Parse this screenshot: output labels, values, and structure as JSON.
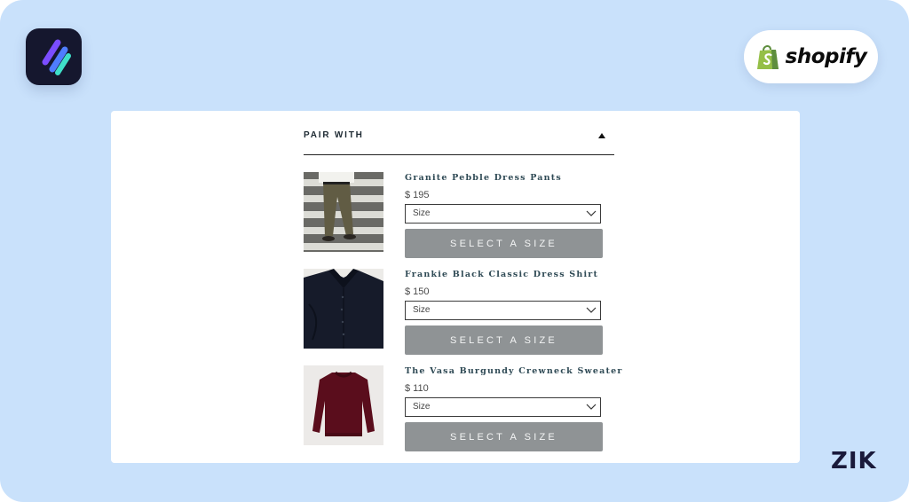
{
  "brand": {
    "app_icon": "app-stripes-logo",
    "platform_wordmark": "shopify",
    "corner_logo": "ZIK"
  },
  "section": {
    "title": "PAIR WITH",
    "toggle_icon": "caret-up-icon"
  },
  "products": [
    {
      "name": "Granite Pebble Dress Pants",
      "price": "$ 195",
      "size_placeholder": "Size",
      "button_label": "SELECT A SIZE",
      "image": "pants-photo"
    },
    {
      "name": "Frankie Black Classic Dress Shirt",
      "price": "$ 150",
      "size_placeholder": "Size",
      "button_label": "SELECT A SIZE",
      "image": "shirt-photo"
    },
    {
      "name": "The Vasa Burgundy Crewneck Sweater",
      "price": "$ 110",
      "size_placeholder": "Size",
      "button_label": "SELECT A SIZE",
      "image": "sweater-photo"
    }
  ],
  "colors": {
    "page_background": "#c9e1fb",
    "button_background": "#8f9395",
    "product_name": "#2f4a55",
    "shopify_green": "#95bf47"
  }
}
